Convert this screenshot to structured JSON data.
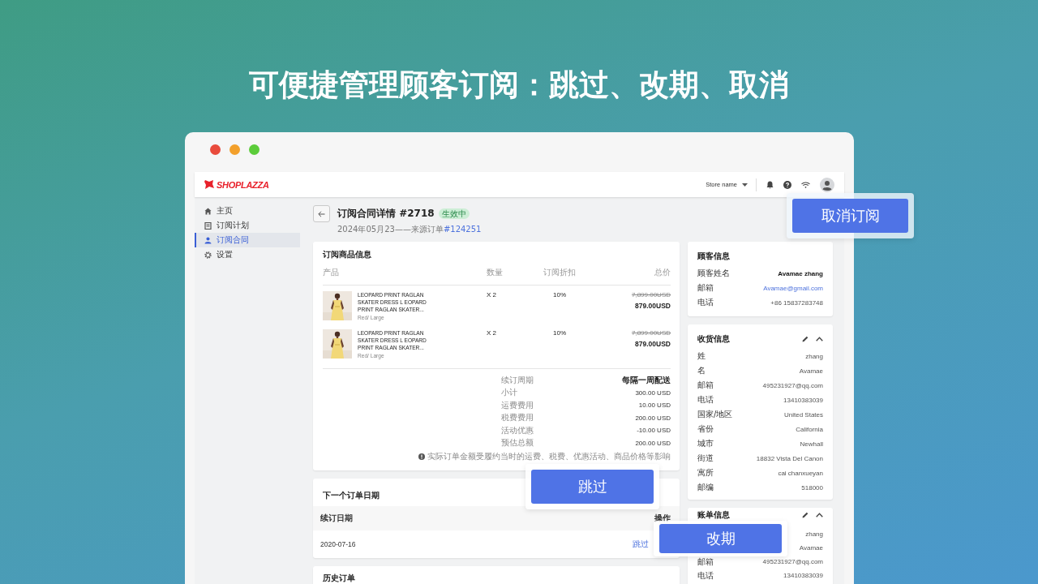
{
  "headline": "可便捷管理顾客订阅：跳过、改期、取消",
  "app": {
    "logo": "SHOPLAZZA",
    "store_name": "Store name"
  },
  "sidebar": {
    "items": [
      {
        "label": "主页",
        "selected": false
      },
      {
        "label": "订阅计划",
        "selected": false
      },
      {
        "label": "订阅合同",
        "selected": true
      },
      {
        "label": "设置",
        "selected": false
      }
    ]
  },
  "page": {
    "title": "订阅合同详情 #2718",
    "status": "生效中",
    "subtitle": "2024年05月23——来源订单",
    "order_link": "#124251"
  },
  "products": {
    "title": "订阅商品信息",
    "columns": [
      "产品",
      "数量",
      "订阅折扣",
      "总价"
    ],
    "rows": [
      {
        "name": "LEOPARD PRINT RAGLAN SKATER DRESS L EOPARD PRINT RAGLAN SKATER...",
        "variant": "Red/ Large",
        "quantity": "X 2",
        "discount": "10%",
        "original_price": "7,899.00USD",
        "price": "879.00USD"
      },
      {
        "name": "LEOPARD PRINT RAGLAN SKATER DRESS L EOPARD PRINT RAGLAN SKATER...",
        "variant": "Red/ Large",
        "quantity": "X 2",
        "discount": "10%",
        "original_price": "7,899.00USD",
        "price": "879.00USD"
      }
    ],
    "summary": [
      {
        "label": "续订周期",
        "value": "每隔一周配送",
        "bold": true
      },
      {
        "label": "小计",
        "value": "300.00 USD",
        "bold": false
      },
      {
        "label": "运费费用",
        "value": "10.00 USD",
        "bold": false
      },
      {
        "label": "税费费用",
        "value": "200.00 USD",
        "bold": false
      },
      {
        "label": "活动优惠",
        "value": "-10.00 USD",
        "bold": false
      },
      {
        "label": "预估总额",
        "value": "200.00 USD",
        "bold": false
      }
    ],
    "note": "实际订单金额受履约当时的运费、税费、优惠活动、商品价格等影响"
  },
  "next_order": {
    "title": "下一个订单日期",
    "columns": [
      "续订日期",
      "操作"
    ],
    "rows": [
      {
        "date": "2020-07-16",
        "action": "跳过"
      }
    ]
  },
  "history": {
    "title": "历史订单"
  },
  "customer": {
    "title": "顾客信息",
    "rows": [
      {
        "label": "顾客姓名",
        "value": "Avamae zhang",
        "kind": "bold"
      },
      {
        "label": "邮箱",
        "value": "Avamae@gmail.com",
        "kind": "link"
      },
      {
        "label": "电话",
        "value": "+86 15837283748",
        "kind": "plain"
      }
    ]
  },
  "shipping": {
    "title": "收货信息",
    "rows": [
      {
        "label": "姓",
        "value": "zhang"
      },
      {
        "label": "名",
        "value": "Avamae"
      },
      {
        "label": "邮箱",
        "value": "495231927@qq.com"
      },
      {
        "label": "电话",
        "value": "13410383039"
      },
      {
        "label": "国家/地区",
        "value": "United States"
      },
      {
        "label": "省份",
        "value": "California"
      },
      {
        "label": "城市",
        "value": "Newhall"
      },
      {
        "label": "街道",
        "value": "18832 Vista Del Canon"
      },
      {
        "label": "寓所",
        "value": "cai chanxueyan"
      },
      {
        "label": "邮编",
        "value": "518000"
      }
    ]
  },
  "billing": {
    "title": "账单信息",
    "rows": [
      {
        "value": "zhang"
      },
      {
        "value": "Avamae"
      },
      {
        "label": "邮箱",
        "value": "495231927@qq.com"
      },
      {
        "label": "电话",
        "value": "13410383039"
      }
    ]
  },
  "callouts": [
    {
      "label": "取消订阅"
    },
    {
      "label": "跳过"
    },
    {
      "label": "改期"
    }
  ]
}
